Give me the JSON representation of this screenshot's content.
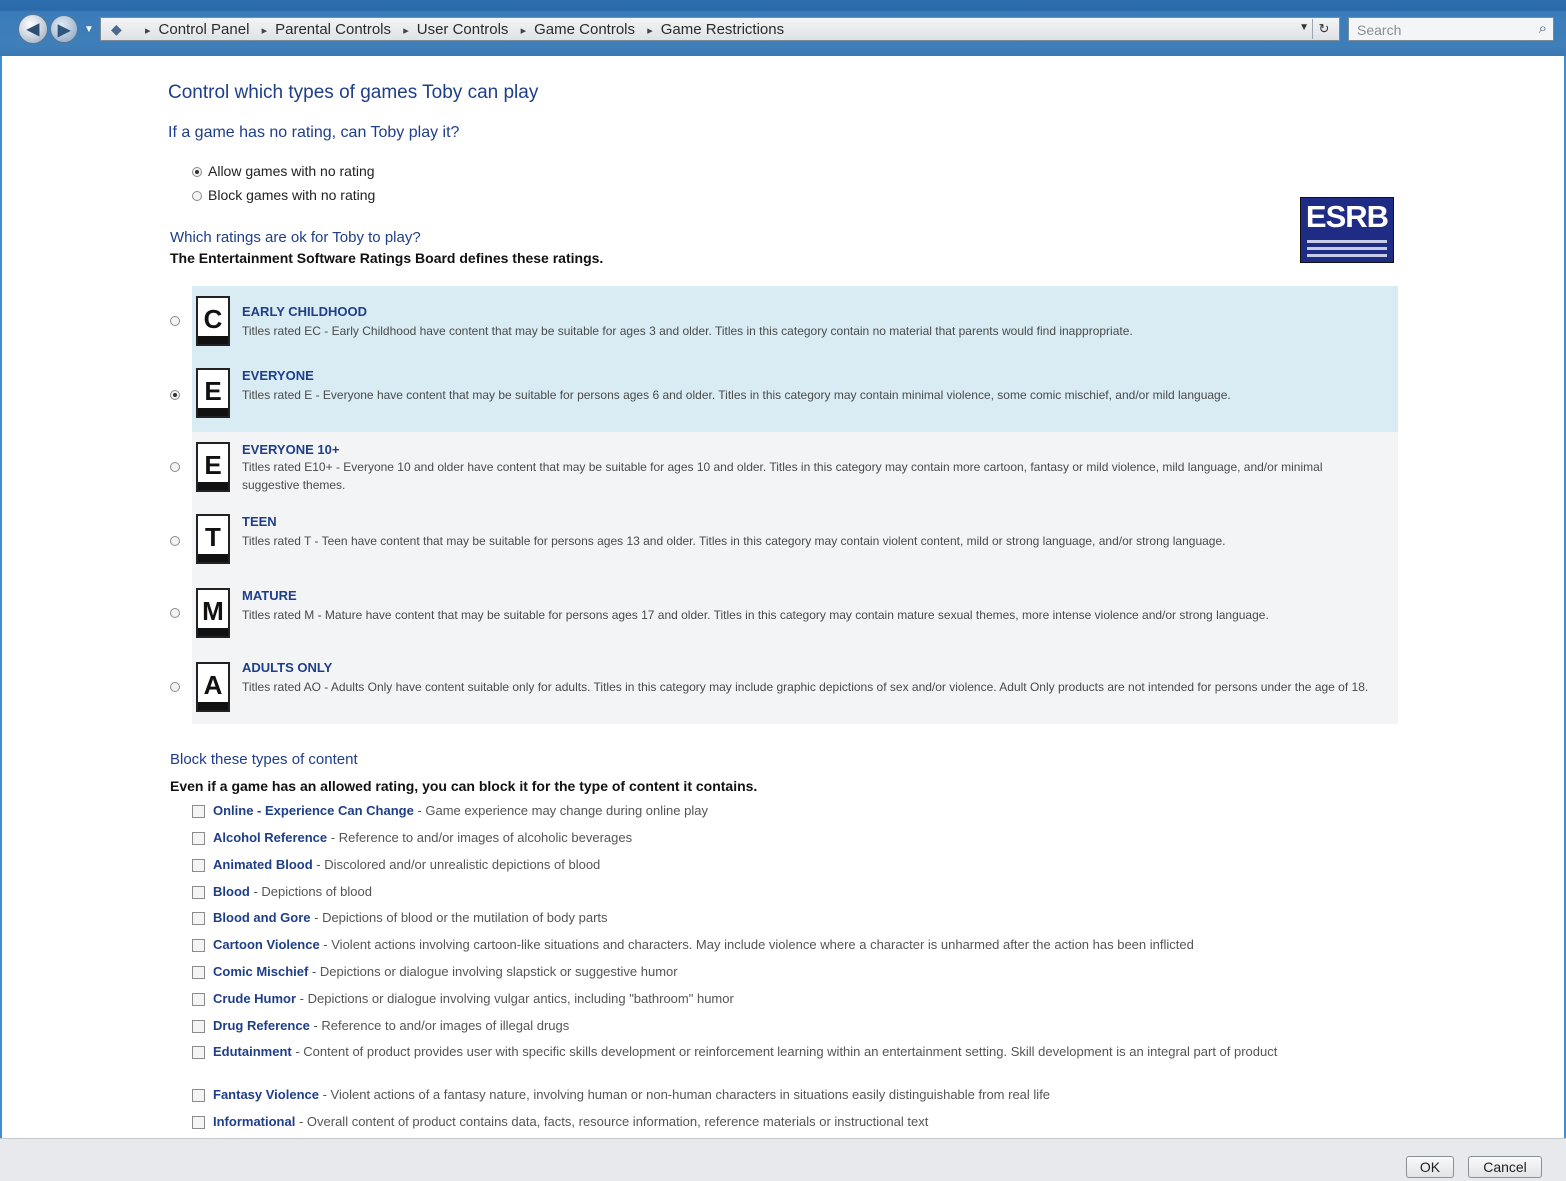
{
  "address_bar": {
    "breadcrumbs": [
      "Control Panel",
      "Parental Controls",
      "User Controls",
      "Game Controls",
      "Game Restrictions"
    ],
    "search_placeholder": "Search"
  },
  "page": {
    "heading": "Control which types of games Toby can play",
    "no_rating_question": "If a game has no rating, can Toby play it?",
    "no_rating_options": [
      {
        "label": "Allow games with no rating",
        "selected": true
      },
      {
        "label": "Block games with no rating",
        "selected": false
      }
    ],
    "ratings_question": "Which ratings are ok for Toby to play?",
    "ratings_note": "The Entertainment Software Ratings Board defines these ratings.",
    "esrb_logo": "ESRB"
  },
  "ratings": [
    {
      "letter": "C",
      "name": "EARLY CHILDHOOD",
      "desc": "Titles rated EC - Early Childhood have content that may be suitable for ages 3 and older. Titles in this category contain no material that parents would find inappropriate.",
      "selected": false
    },
    {
      "letter": "E",
      "name": "EVERYONE",
      "desc": "Titles rated E - Everyone have content that may be suitable for persons ages 6 and older. Titles in this category may contain minimal violence, some comic mischief, and/or mild language.",
      "selected": true
    },
    {
      "letter": "E",
      "name": "EVERYONE 10+",
      "desc": "Titles rated E10+ - Everyone 10 and older have content that may be suitable for ages 10 and older. Titles in this category may contain more cartoon, fantasy or mild violence, mild language, and/or minimal suggestive themes.",
      "selected": false
    },
    {
      "letter": "T",
      "name": "TEEN",
      "desc": "Titles rated T - Teen have content that may be suitable for persons ages 13 and older. Titles in this category may contain violent content, mild or strong language, and/or strong language.",
      "selected": false
    },
    {
      "letter": "M",
      "name": "MATURE",
      "desc": "Titles rated M - Mature have content that may be suitable for persons ages 17 and older. Titles in this category may contain mature sexual themes, more intense violence and/or strong language.",
      "selected": false
    },
    {
      "letter": "A",
      "name": "ADULTS ONLY",
      "desc": "Titles rated AO - Adults Only have content suitable only for adults. Titles in this category may include graphic depictions of sex and/or violence. Adult Only products are not intended for persons under the age of 18.",
      "selected": false
    }
  ],
  "content_block": {
    "question": "Block these types of content",
    "note": "Even if a game has an allowed rating, you can block it for the type of content it contains.",
    "items": [
      {
        "label": "Online - Experience Can Change",
        "desc": "Game experience may change during online play"
      },
      {
        "label": "Alcohol Reference",
        "desc": "Reference to and/or images of alcoholic beverages"
      },
      {
        "label": "Animated Blood",
        "desc": "Discolored and/or unrealistic depictions of blood"
      },
      {
        "label": "Blood",
        "desc": "Depictions of blood"
      },
      {
        "label": "Blood and Gore",
        "desc": "Depictions of blood or the mutilation of body parts"
      },
      {
        "label": "Cartoon Violence",
        "desc": "Violent actions involving cartoon-like situations and characters. May include violence where a character is unharmed after the action has been inflicted"
      },
      {
        "label": "Comic Mischief",
        "desc": "Depictions or dialogue involving slapstick or suggestive humor"
      },
      {
        "label": "Crude Humor",
        "desc": "Depictions or dialogue involving vulgar antics, including \"bathroom\" humor"
      },
      {
        "label": "Drug Reference",
        "desc": "Reference to and/or images of illegal drugs"
      },
      {
        "label": "Edutainment",
        "desc": "Content of product provides user with specific skills development or reinforcement learning within an entertainment setting. Skill development is an integral part of product"
      },
      {
        "label": "Fantasy Violence",
        "desc": "Violent actions of a fantasy nature, involving human or non-human characters in situations easily distinguishable from real life"
      },
      {
        "label": "Informational",
        "desc": "Overall content of product contains data, facts, resource information, reference materials or instructional text"
      }
    ]
  },
  "buttons": {
    "ok": "OK",
    "cancel": "Cancel"
  }
}
